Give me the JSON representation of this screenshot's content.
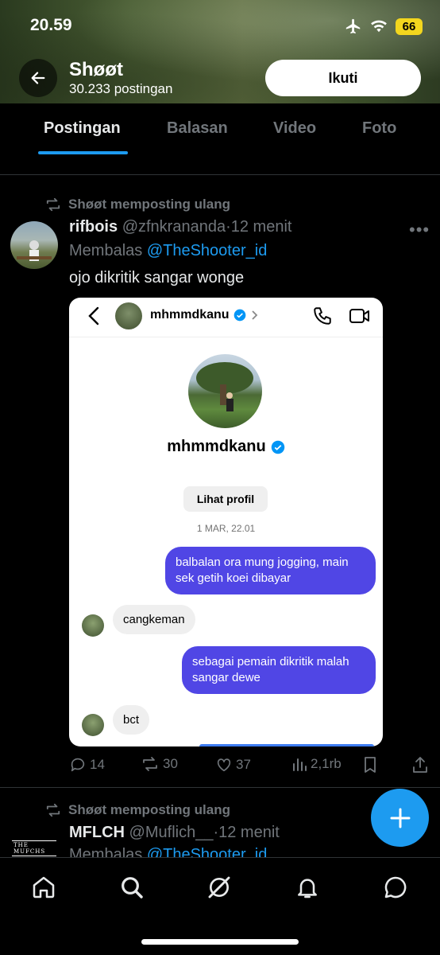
{
  "status_bar": {
    "time": "20.59",
    "battery": "66"
  },
  "header": {
    "profile_name": "Shøøt",
    "post_count": "30.233 postingan",
    "follow_label": "Ikuti"
  },
  "tabs": [
    {
      "label": "Postingan",
      "active": true
    },
    {
      "label": "Balasan",
      "active": false
    },
    {
      "label": "Video",
      "active": false
    },
    {
      "label": "Foto",
      "active": false
    }
  ],
  "post1": {
    "repost_label": "Shøøt memposting ulang",
    "author_name": "rifbois",
    "author_handle": "@zfnkrananda",
    "time": "12 menit",
    "reply_prefix": "Membalas",
    "reply_to": "@TheShooter_id",
    "text": "ojo dikritik sangar wonge",
    "screenshot": {
      "username": "mhmmdkanu",
      "profile_name": "mhmmdkanu",
      "view_profile": "Lihat profil",
      "date": "1 MAR, 22.01",
      "messages": [
        {
          "direction": "out",
          "text": "balbalan ora mung jogging, main sek getih koei dibayar"
        },
        {
          "direction": "in",
          "text": "cangkeman"
        },
        {
          "direction": "out",
          "text": "sebagai pemain dikritik malah sangar dewe"
        },
        {
          "direction": "in",
          "text": "bct"
        }
      ]
    },
    "stats": {
      "replies": "14",
      "reposts": "30",
      "likes": "37",
      "views": "2,1rb"
    }
  },
  "post2": {
    "repost_label": "Shøøt memposting ulang",
    "avatar_text": "THE MUFCHS",
    "author_name": "MFLCH",
    "author_handle": "@Muflich__",
    "time": "12 menit",
    "reply_prefix": "Membalas",
    "reply_to": "@TheShooter_id"
  },
  "colors": {
    "accent": "#1d9bf0",
    "dm_bubble": "#5046e5",
    "background": "#000000"
  }
}
